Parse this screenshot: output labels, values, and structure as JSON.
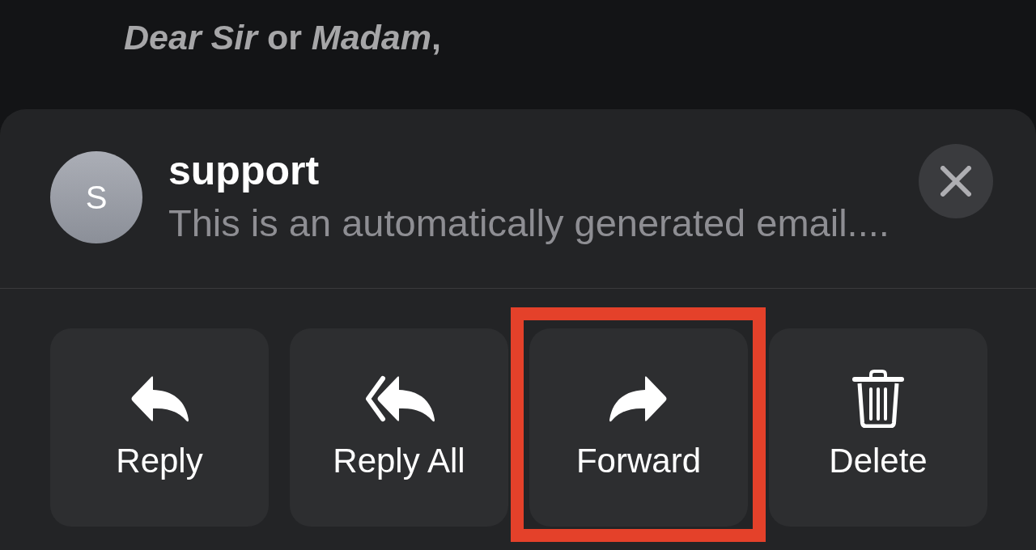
{
  "message": {
    "greeting": "*Dear Sir* or *Madam*,"
  },
  "sheet": {
    "sender": {
      "initial": "S",
      "name": "support",
      "snippet": "This is an automatically generated email...."
    },
    "actions": [
      {
        "kind": "reply",
        "label": "Reply",
        "highlighted": false
      },
      {
        "kind": "reply_all",
        "label": "Reply All",
        "highlighted": false
      },
      {
        "kind": "forward",
        "label": "Forward",
        "highlighted": true
      },
      {
        "kind": "delete",
        "label": "Delete",
        "highlighted": false
      }
    ]
  }
}
